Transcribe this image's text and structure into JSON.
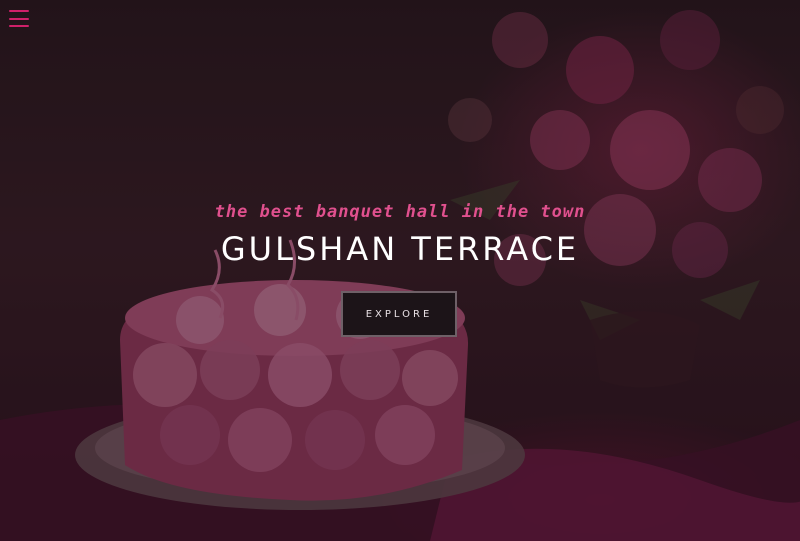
{
  "nav": {
    "menu_icon": "hamburger-menu-icon",
    "menu_color": "#d0206a"
  },
  "hero": {
    "tagline": "the best banquet hall in the town",
    "title": "GULSHAN TERRACE",
    "explore_label": "EXPLORE",
    "tagline_color": "#e0508e",
    "title_color": "#ffffff"
  }
}
